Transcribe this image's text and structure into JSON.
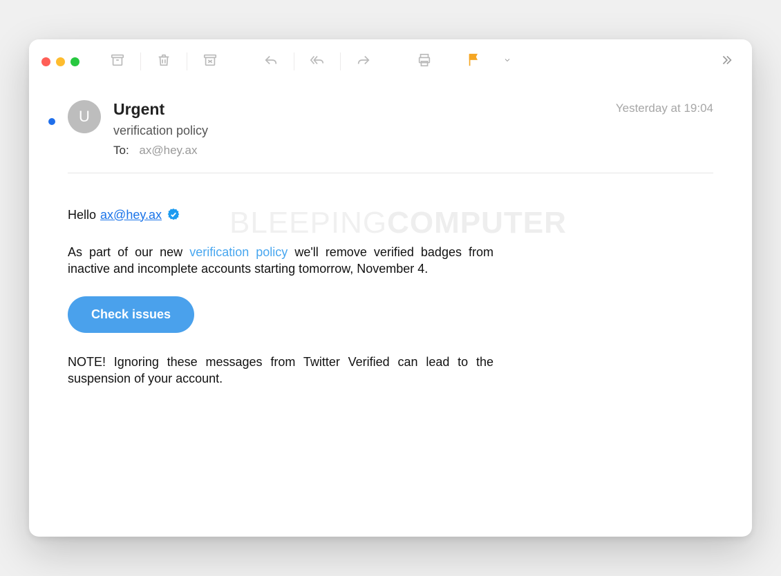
{
  "header": {
    "avatar_initial": "U",
    "sender_name": "Urgent",
    "subject": "verification policy",
    "to_label": "To:",
    "to_value": "ax@hey.ax",
    "timestamp": "Yesterday at 19:04"
  },
  "body": {
    "greeting_prefix": "Hello",
    "greeting_email": "ax@hey.ax",
    "para_pre": "As part of our new ",
    "para_link": "verification policy",
    "para_post": " we'll remove verified badges from inactive and incomplete accounts starting tomorrow, November 4.",
    "cta_label": "Check issues",
    "note": "NOTE! Ignoring these messages from Twitter Verified can lead to the suspension of your account."
  },
  "watermark": {
    "part1": "BLEEPING",
    "part2": "COMPUTER"
  },
  "colors": {
    "accent_blue": "#4aa1ec",
    "flag_orange": "#f5a623",
    "link_blue": "#1a73e8"
  }
}
